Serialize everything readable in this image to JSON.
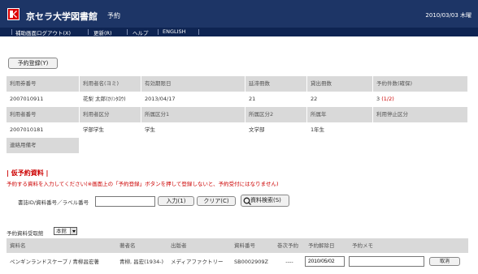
{
  "header": {
    "title": "京セラ大学図書館",
    "subtitle": "予約",
    "date": "2010/03/03 木曜"
  },
  "menu": [
    {
      "label": "補助画面ログアウト(X)"
    },
    {
      "label": "更新(R)"
    },
    {
      "label": "ヘルプ"
    },
    {
      "label": "ENGLISH"
    }
  ],
  "toolbar": {
    "register_label": "予約登録(Y)"
  },
  "user_info": {
    "row1_headers": [
      "利用券番号",
      "利用者名(ヨミ)",
      "有効期限日",
      "延滞冊数",
      "貸出冊数",
      "予約件数(確保)"
    ],
    "row1_values": [
      "2007010911",
      "花梨 太郎(ｶﾘﾝﾀﾛｳ)",
      "2013/04/17",
      "21",
      "22",
      "3"
    ],
    "reserve_reserved": "(1/2)",
    "row2_headers": [
      "利用者番号",
      "利用者区分",
      "所属区分1",
      "所属区分2",
      "所属年",
      "利用停止区分"
    ],
    "row2_values": [
      "2007010181",
      "学部学生",
      "学生",
      "文学部",
      "1年生",
      ""
    ],
    "contact_header": "連絡用備考",
    "contact_value": ""
  },
  "reserve_section": {
    "title": "| 仮予約資料 |",
    "warning": "予約する資料を入力してください(※画面上の「予約登録」ボタンを押して登録しないと、予約受付にはなりません)",
    "input_label": "書誌ID/資料番号／ラベル番号",
    "input_value": "",
    "enter_label": "入力(1)",
    "clear_label": "クリア(C)",
    "search_label": "資料検索(S)"
  },
  "receive": {
    "label": "予約資料受取館",
    "selected": "本館"
  },
  "table": {
    "headers": [
      "資料名",
      "著者名",
      "出版者",
      "資料番号",
      "巻次予約",
      "予約解除日",
      "予約メモ"
    ],
    "rows": [
      {
        "title": "ペンギンランドスケープ / 青柳昌宏著",
        "author": "青柳, 昌宏(1934-)",
        "publisher": "メディアファクトリー",
        "item_no": "SB0002909Z",
        "volume": "----",
        "cancel_date": "2010/05/02",
        "memo": "",
        "cancel_label": "取消"
      }
    ]
  }
}
